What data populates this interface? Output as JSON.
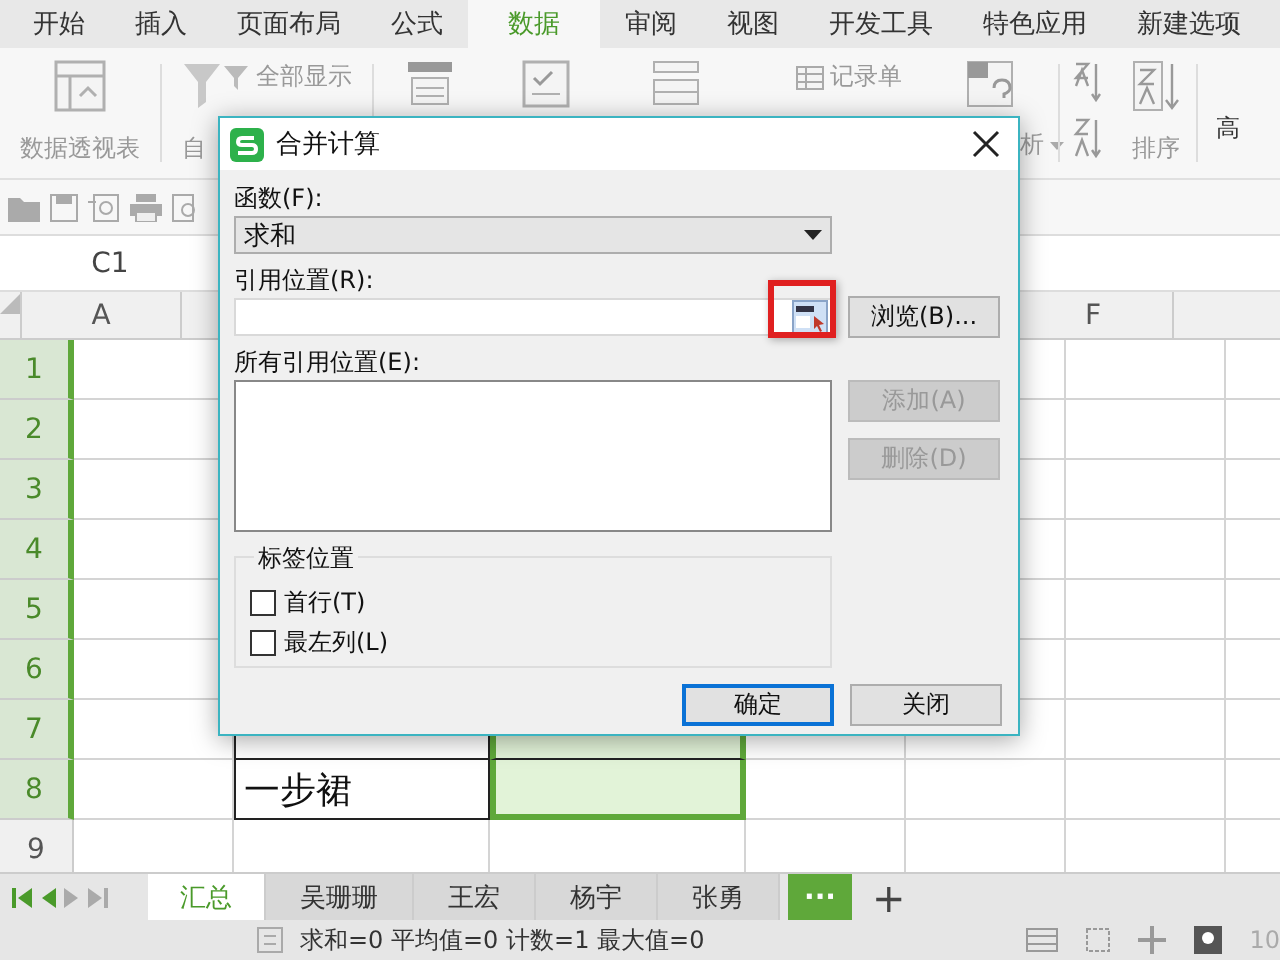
{
  "ribbon_tabs": [
    {
      "label": "开始",
      "selected": false
    },
    {
      "label": "插入",
      "selected": false
    },
    {
      "label": "页面布局",
      "selected": false
    },
    {
      "label": "公式",
      "selected": false
    },
    {
      "label": "数据",
      "selected": true
    },
    {
      "label": "审阅",
      "selected": false
    },
    {
      "label": "视图",
      "selected": false
    },
    {
      "label": "开发工具",
      "selected": false
    },
    {
      "label": "特色应用",
      "selected": false
    },
    {
      "label": "新建选项",
      "selected": false
    }
  ],
  "ribbon": {
    "pivot_label": "数据透视表",
    "auto_filter_label": "自",
    "show_all_label": "全部显示",
    "record_label": "记录单",
    "analysis_label": "析",
    "sort_label": "排序",
    "advanced_label": "高"
  },
  "name_box": "C1",
  "column_headers": [
    "A",
    "F"
  ],
  "rows": [
    {
      "number": "1",
      "selected": true,
      "bordered": false
    },
    {
      "number": "2",
      "selected": true,
      "bordered": false
    },
    {
      "number": "3",
      "selected": true,
      "bordered": false
    },
    {
      "number": "4",
      "selected": true,
      "bordered": false
    },
    {
      "number": "5",
      "selected": true,
      "bordered": false
    },
    {
      "number": "6",
      "selected": true,
      "bordered": false
    },
    {
      "number": "7",
      "selected": true,
      "bordered": true
    },
    {
      "number": "8",
      "selected": true,
      "bordered": true,
      "text": "一步裙"
    },
    {
      "number": "9",
      "selected": false,
      "bordered": false
    }
  ],
  "dialog": {
    "title": "合并计算",
    "function_label": "函数(F):",
    "function_value": "求和",
    "reference_label": "引用位置(R):",
    "reference_picker_highlighted": true,
    "browse_button": "浏览(B)...",
    "all_references_label": "所有引用位置(E):",
    "add_button": {
      "label": "添加(A)",
      "disabled": true
    },
    "delete_button": {
      "label": "删除(D)",
      "disabled": true
    },
    "label_group": "标签位置",
    "checkboxes": [
      {
        "label": "首行(T)",
        "checked": false
      },
      {
        "label": "最左列(L)",
        "checked": false
      }
    ],
    "ok_button": "确定",
    "close_button": "关闭"
  },
  "sheet_tabs": [
    {
      "label": "汇总",
      "selected": true
    },
    {
      "label": "吴珊珊",
      "selected": false
    },
    {
      "label": "王宏",
      "selected": false
    },
    {
      "label": "杨宇",
      "selected": false
    },
    {
      "label": "张勇",
      "selected": false
    }
  ],
  "more_sheets_button": "···",
  "add_sheet_button": "+",
  "status_bar": {
    "summary": "求和=0 平均值=0 计数=1 最大值=0",
    "zoom": "10"
  }
}
